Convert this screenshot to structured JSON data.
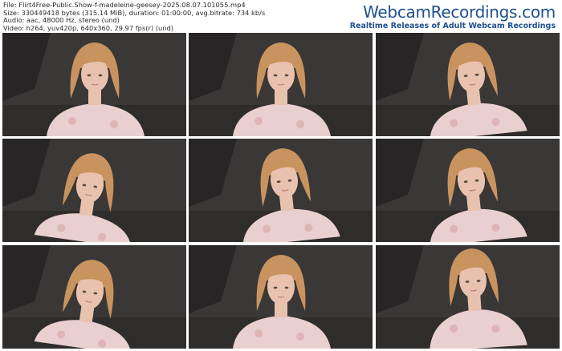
{
  "header": {
    "file_line": "File: Flirt4Free-Public.Show-f-madeleine-geesey-2025.08.07.101055.mp4",
    "size_line": "Size: 330449418 bytes (315.14 MiB), duration: 01:00:00, avg.bitrate: 734 kb/s",
    "audio_line": "Audio: aac, 48000 Hz, stereo (und)",
    "video_line": "Video: h264, yuv420p, 640x360, 29.97 fps(r) (und)"
  },
  "brand": {
    "title": "WebcamRecordings.com",
    "tagline": "Realtime Releases of Adult Webcam Recordings"
  },
  "thumbnails": [
    {
      "id": 1,
      "pose": "front"
    },
    {
      "id": 2,
      "pose": "front"
    },
    {
      "id": 3,
      "pose": "turned"
    },
    {
      "id": 4,
      "pose": "looking-down"
    },
    {
      "id": 5,
      "pose": "turned"
    },
    {
      "id": 6,
      "pose": "turned"
    },
    {
      "id": 7,
      "pose": "looking-down"
    },
    {
      "id": 8,
      "pose": "front"
    },
    {
      "id": 9,
      "pose": "close-turned"
    }
  ],
  "colors": {
    "background": "#ffffff",
    "brand": "#1f4f8f",
    "wall": "#3a3737",
    "hair": "#c9935f",
    "skin": "#e8c2ae",
    "shirt": "#e9cfcf"
  }
}
